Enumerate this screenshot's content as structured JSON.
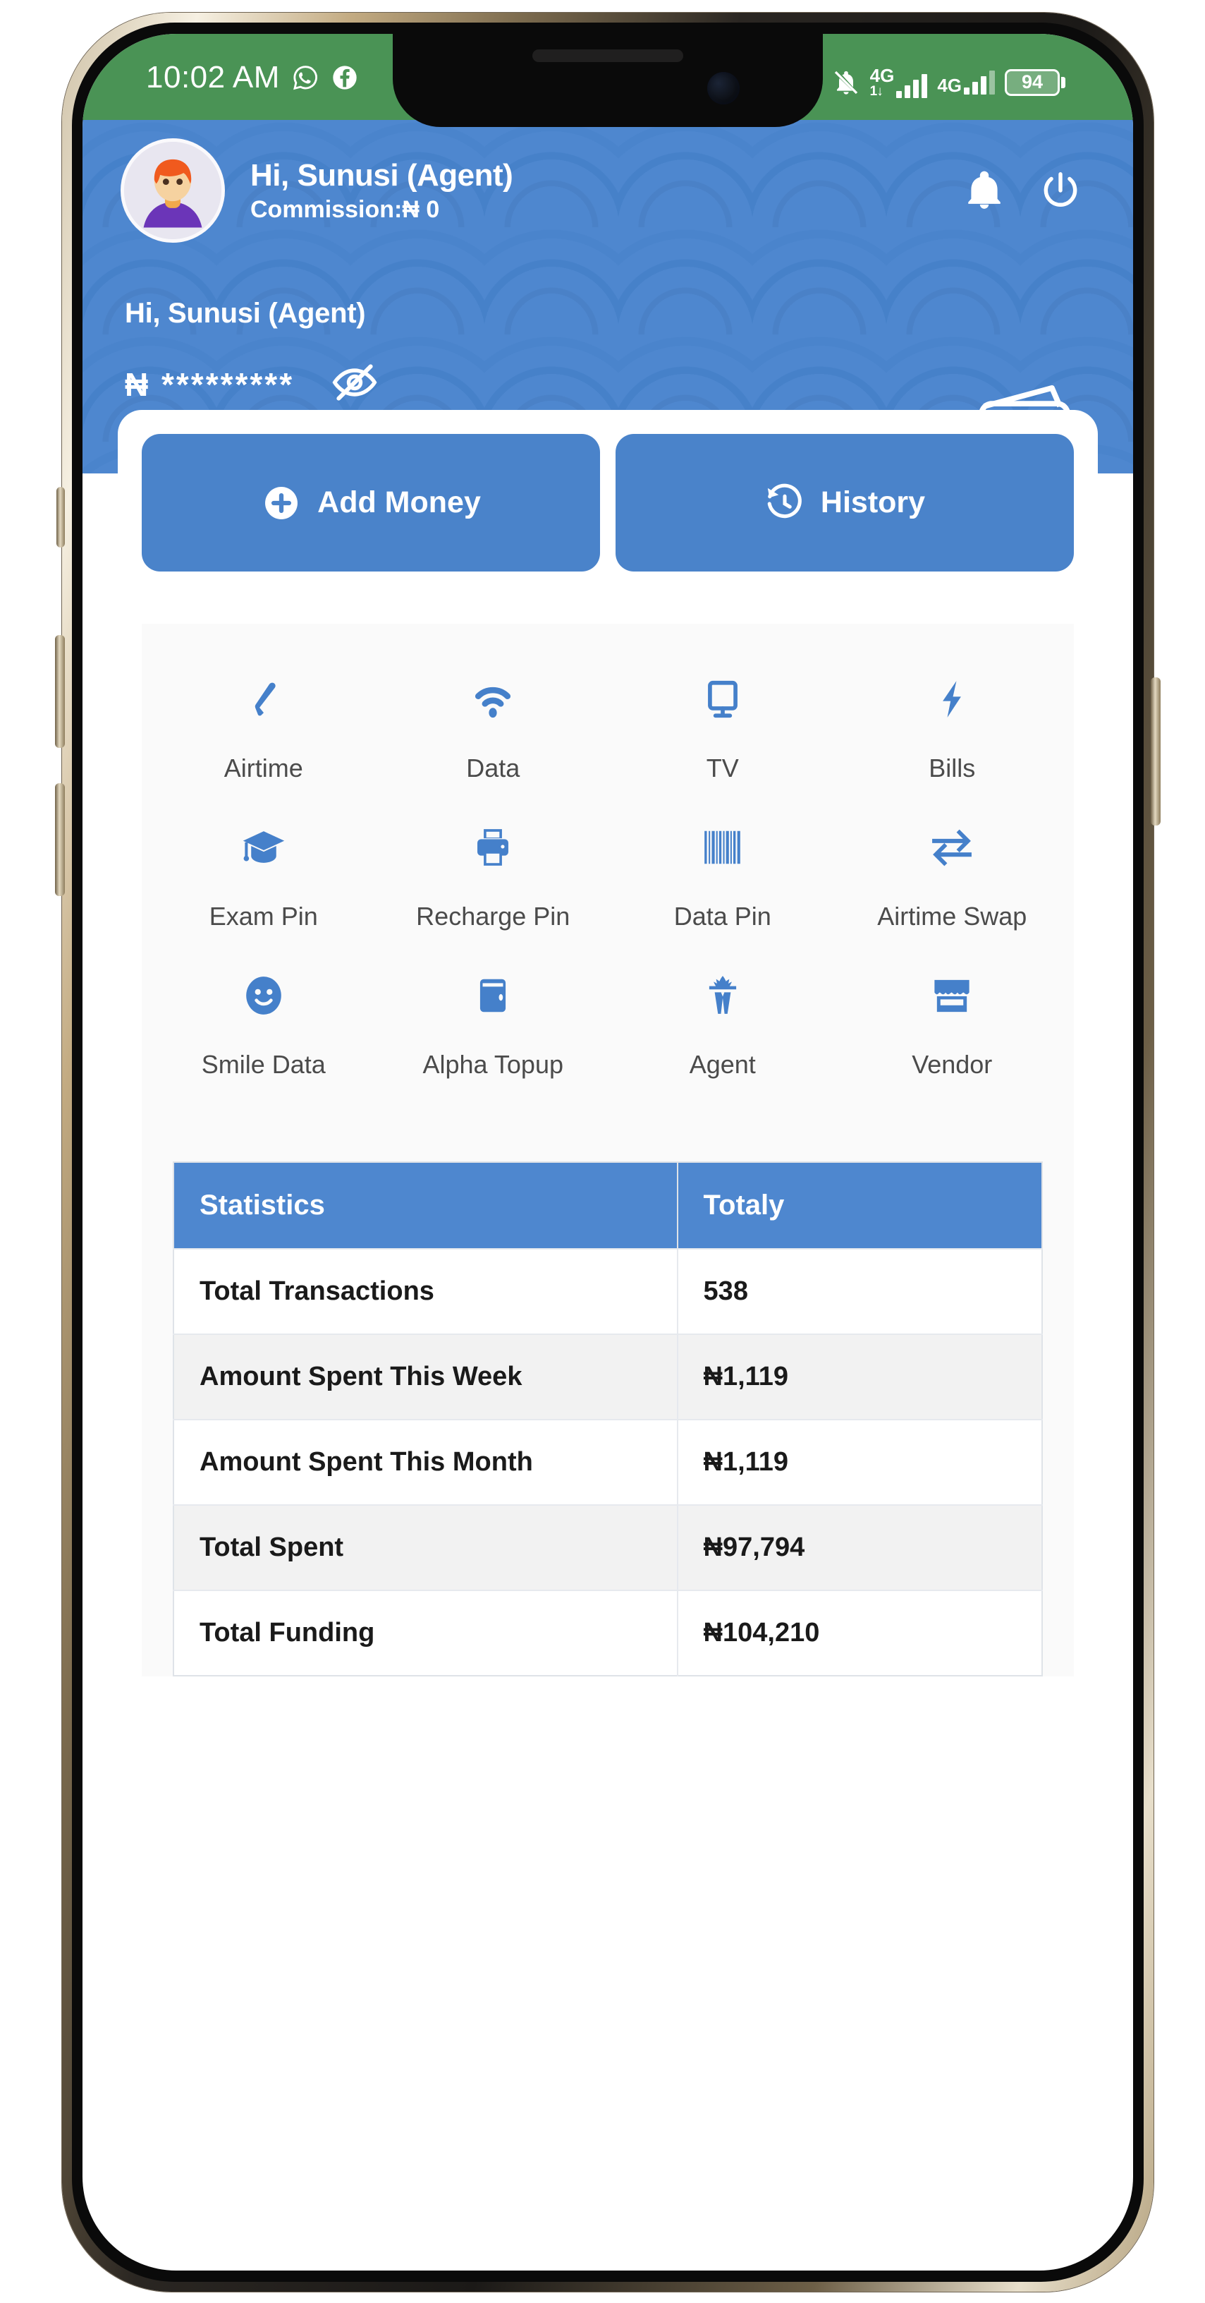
{
  "status_bar": {
    "time": "10:02 AM",
    "left_icons": [
      "whatsapp-icon",
      "facebook-icon"
    ],
    "right_icons": [
      "bell-mute-icon",
      "signal-4g-icon",
      "signal-4g-icon"
    ],
    "network_label_1": "4G",
    "network_sub_1": "1↓",
    "network_label_2": "4G",
    "battery_percent": "94",
    "bar_color": "#4a9355"
  },
  "header": {
    "greeting": "Hi, Sunusi (Agent)",
    "commission": "Commission:₦ 0",
    "bell_icon": "bell-icon",
    "power_icon": "power-icon",
    "avatar": "user-avatar"
  },
  "balance": {
    "name": "Hi, Sunusi (Agent)",
    "amount_masked": "₦ *********",
    "toggle_icon": "eye-off-icon",
    "commission": "Commission: ₦0",
    "wallet_icon": "wallet-icon",
    "hero_color": "#4e87cf"
  },
  "actions": [
    {
      "label": "Add Money",
      "icon": "plus-circle-icon"
    },
    {
      "label": "History",
      "icon": "history-icon"
    }
  ],
  "services": [
    [
      {
        "label": "Airtime",
        "icon": "phone-icon"
      },
      {
        "label": "Data",
        "icon": "wifi-icon"
      },
      {
        "label": "TV",
        "icon": "tv-icon"
      },
      {
        "label": "Bills",
        "icon": "bolt-icon"
      }
    ],
    [
      {
        "label": "Exam Pin",
        "icon": "graduation-cap-icon"
      },
      {
        "label": "Recharge Pin",
        "icon": "printer-icon"
      },
      {
        "label": "Data Pin",
        "icon": "barcode-icon"
      },
      {
        "label": "Airtime Swap",
        "icon": "exchange-arrows-icon"
      }
    ],
    [
      {
        "label": "Smile Data",
        "icon": "smiley-icon"
      },
      {
        "label": "Alpha Topup",
        "icon": "wallet-small-icon"
      },
      {
        "label": "Agent",
        "icon": "spy-agent-icon"
      },
      {
        "label": "Vendor",
        "icon": "store-icon"
      }
    ]
  ],
  "stats_table": {
    "columns": [
      "Statistics",
      "Totaly"
    ],
    "rows": [
      {
        "label": "Total Transactions",
        "value": "538"
      },
      {
        "label": "Amount Spent This Week",
        "value": "₦1,119"
      },
      {
        "label": "Amount Spent This Month",
        "value": "₦1,119"
      },
      {
        "label": "Total Spent",
        "value": "₦97,794"
      },
      {
        "label": "Total Funding",
        "value": "₦104,210"
      }
    ]
  },
  "colors": {
    "accent_blue": "#4e87cf",
    "button_blue": "#4a83ca",
    "status_green": "#4a9355",
    "icon_blue": "#4580ca"
  }
}
